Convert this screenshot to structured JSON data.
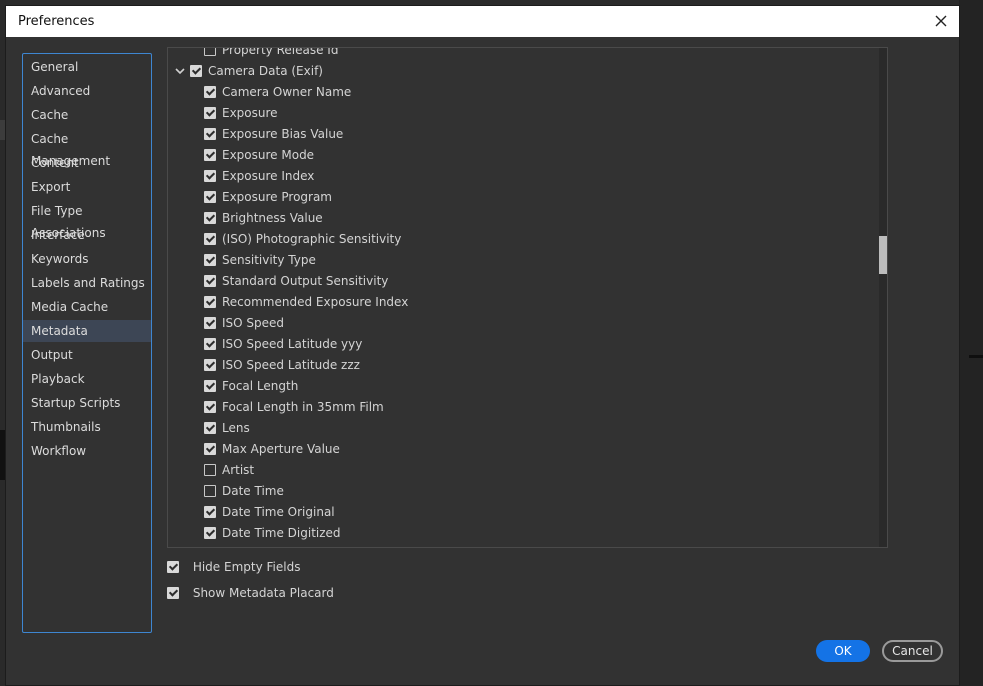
{
  "window": {
    "title": "Preferences"
  },
  "sidebar": {
    "items": [
      {
        "label": "General"
      },
      {
        "label": "Advanced"
      },
      {
        "label": "Cache"
      },
      {
        "label": "Cache Management"
      },
      {
        "label": "Content"
      },
      {
        "label": "Export"
      },
      {
        "label": "File Type Associations"
      },
      {
        "label": "Interface"
      },
      {
        "label": "Keywords"
      },
      {
        "label": "Labels and Ratings"
      },
      {
        "label": "Media Cache"
      },
      {
        "label": "Metadata"
      },
      {
        "label": "Output"
      },
      {
        "label": "Playback"
      },
      {
        "label": "Startup Scripts"
      },
      {
        "label": "Thumbnails"
      },
      {
        "label": "Workflow"
      }
    ],
    "selected": "Metadata"
  },
  "metadata_tree": {
    "partial_row": {
      "label": "Property Release Id",
      "checked": false
    },
    "group": {
      "label": "Camera Data (Exif)",
      "checked": true,
      "expanded": true
    },
    "fields": [
      {
        "label": "Camera Owner Name",
        "checked": true
      },
      {
        "label": "Exposure",
        "checked": true
      },
      {
        "label": "Exposure Bias Value",
        "checked": true
      },
      {
        "label": "Exposure Mode",
        "checked": true
      },
      {
        "label": "Exposure Index",
        "checked": true
      },
      {
        "label": "Exposure Program",
        "checked": true
      },
      {
        "label": "Brightness Value",
        "checked": true
      },
      {
        "label": "(ISO) Photographic Sensitivity",
        "checked": true
      },
      {
        "label": "Sensitivity Type",
        "checked": true
      },
      {
        "label": "Standard Output Sensitivity",
        "checked": true
      },
      {
        "label": "Recommended Exposure Index",
        "checked": true
      },
      {
        "label": "ISO Speed",
        "checked": true
      },
      {
        "label": "ISO Speed Latitude yyy",
        "checked": true
      },
      {
        "label": "ISO Speed Latitude zzz",
        "checked": true
      },
      {
        "label": "Focal Length",
        "checked": true
      },
      {
        "label": "Focal Length in 35mm Film",
        "checked": true
      },
      {
        "label": "Lens",
        "checked": true
      },
      {
        "label": "Max Aperture Value",
        "checked": true
      },
      {
        "label": "Artist",
        "checked": false
      },
      {
        "label": "Date Time",
        "checked": false
      },
      {
        "label": "Date Time Original",
        "checked": true
      },
      {
        "label": "Date Time Digitized",
        "checked": true
      }
    ]
  },
  "options": {
    "hide_empty_fields": {
      "label": "Hide Empty Fields",
      "checked": true
    },
    "show_metadata_placard": {
      "label": "Show Metadata Placard",
      "checked": true
    }
  },
  "buttons": {
    "ok": "OK",
    "cancel": "Cancel"
  },
  "colors": {
    "accent": "#1473e6",
    "selection": "#3d4655",
    "sidebar_border": "#3e86d1"
  }
}
